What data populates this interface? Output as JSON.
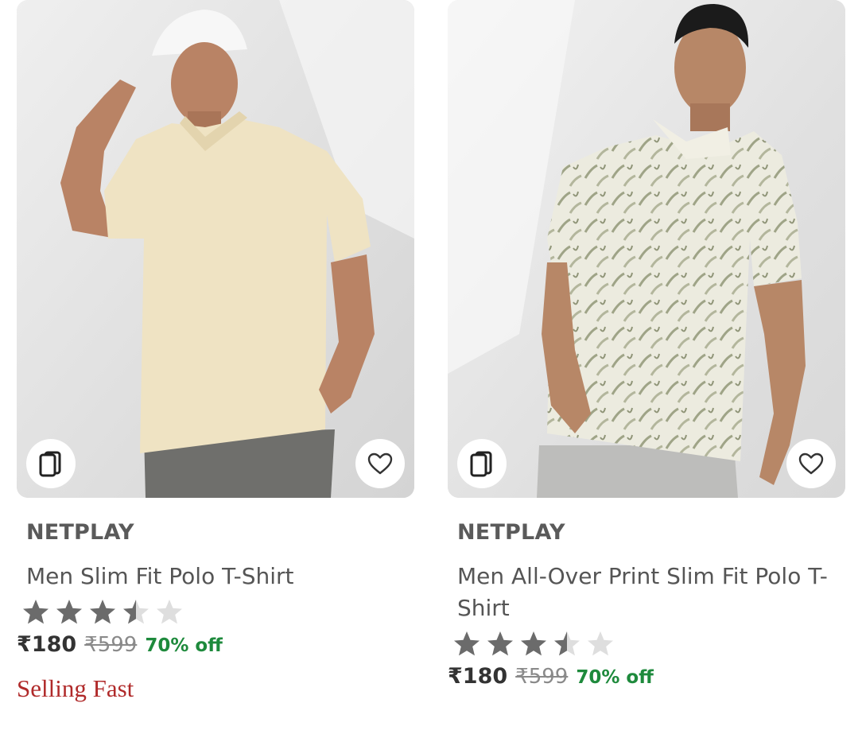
{
  "products": [
    {
      "brand": "NETPLAY",
      "title": "Men Slim Fit Polo T-Shirt",
      "rating": 3.5,
      "price": "₹180",
      "mrp": "₹599",
      "discount": "70% off",
      "tag": "Selling Fast",
      "shirt_color": "#efe3c3"
    },
    {
      "brand": "NETPLAY",
      "title": "Men All-Over Print Slim Fit Polo T-Shirt",
      "rating": 3.5,
      "price": "₹180",
      "mrp": "₹599",
      "discount": "70% off",
      "shirt_color": "#e9e7d8"
    }
  ],
  "colors": {
    "star_filled": "#6b6b6b",
    "star_empty": "#dedede",
    "discount": "#1e8a3c",
    "tag": "#b02a2a"
  },
  "icons": {
    "similar": "similar-products-icon",
    "wishlist": "heart-icon"
  }
}
